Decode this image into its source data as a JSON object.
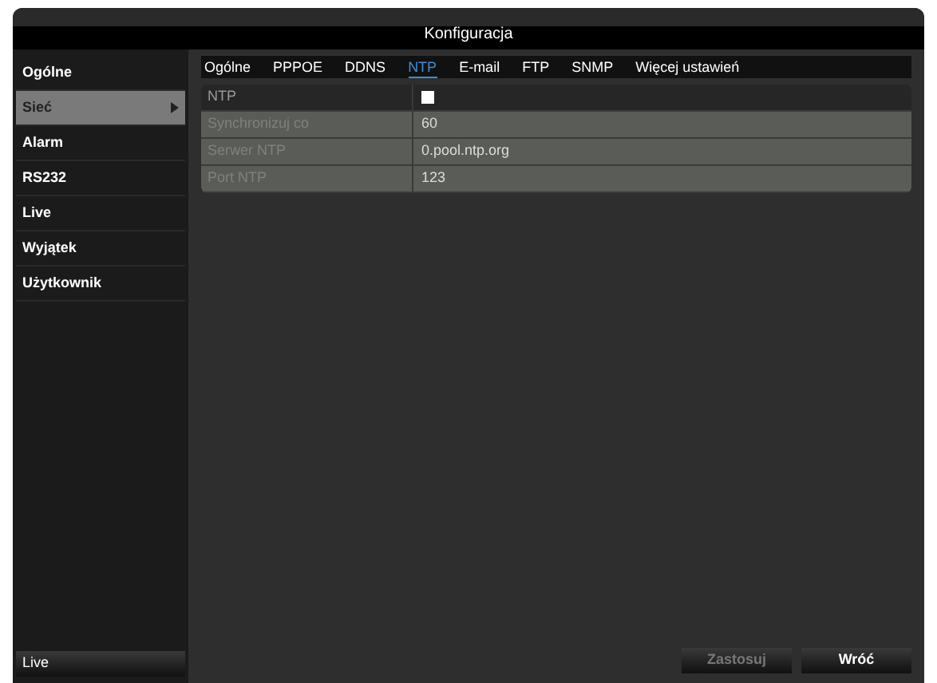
{
  "window": {
    "title": "Konfiguracja"
  },
  "sidebar": {
    "items": [
      {
        "label": "Ogólne",
        "selected": false
      },
      {
        "label": "Sieć",
        "selected": true
      },
      {
        "label": "Alarm",
        "selected": false
      },
      {
        "label": "RS232",
        "selected": false
      },
      {
        "label": "Live",
        "selected": false
      },
      {
        "label": "Wyjątek",
        "selected": false
      },
      {
        "label": "Użytkownik",
        "selected": false
      }
    ],
    "live_button": "Live"
  },
  "tabs": [
    {
      "label": "Ogólne",
      "selected": false
    },
    {
      "label": "PPPOE",
      "selected": false
    },
    {
      "label": "DDNS",
      "selected": false
    },
    {
      "label": "NTP",
      "selected": true
    },
    {
      "label": "E-mail",
      "selected": false
    },
    {
      "label": "FTP",
      "selected": false
    },
    {
      "label": "SNMP",
      "selected": false
    },
    {
      "label": "Więcej ustawień",
      "selected": false
    }
  ],
  "settings": [
    {
      "kind": "checkbox",
      "label": "NTP",
      "disabled": false,
      "checked": false
    },
    {
      "kind": "text",
      "label": "Synchronizuj co",
      "disabled": true,
      "value": "60"
    },
    {
      "kind": "text",
      "label": "Serwer NTP",
      "disabled": true,
      "value": "0.pool.ntp.org"
    },
    {
      "kind": "text",
      "label": "Port NTP",
      "disabled": true,
      "value": "123"
    }
  ],
  "buttons": [
    {
      "label": "Zastosuj",
      "disabled": true
    },
    {
      "label": "Wróć",
      "disabled": false
    }
  ]
}
